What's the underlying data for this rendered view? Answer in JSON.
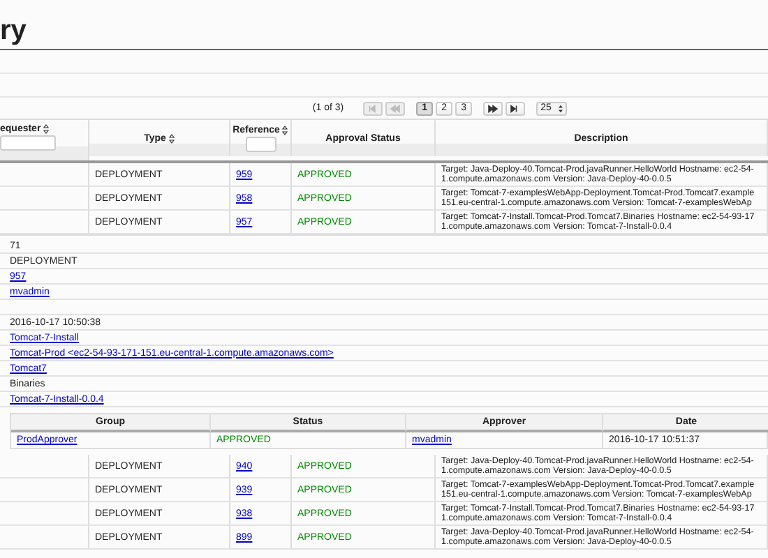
{
  "page": {
    "title": "ry"
  },
  "paginator": {
    "summary": "(1 of 3)",
    "nav": [
      {
        "kind": "first",
        "disabled": true
      },
      {
        "kind": "prev",
        "disabled": true
      },
      {
        "kind": "next",
        "disabled": false
      },
      {
        "kind": "last",
        "disabled": false
      }
    ],
    "pages": [
      {
        "label": "1",
        "selected": true
      },
      {
        "label": "2",
        "selected": false
      },
      {
        "label": "3",
        "selected": false
      }
    ],
    "page_size": "25"
  },
  "table": {
    "columns": [
      {
        "label": "equester",
        "kind": "sort_filter"
      },
      {
        "label": "Type",
        "kind": "sort"
      },
      {
        "label": "Reference",
        "kind": "sort_filter"
      },
      {
        "label": "Approval Status",
        "kind": "plain"
      },
      {
        "label": "Description",
        "kind": "plain"
      }
    ],
    "rows": [
      {
        "type": "DEPLOYMENT",
        "reference": "959",
        "status": "APPROVED",
        "description": [
          "Target: Java-Deploy-40.Tomcat-Prod.javaRunner.HelloWorld Hostname: ec2-54-",
          "1.compute.amazonaws.com Version: Java-Deploy-40-0.0.5"
        ]
      },
      {
        "type": "DEPLOYMENT",
        "reference": "958",
        "status": "APPROVED",
        "description": [
          "Target: Tomcat-7-examplesWebApp-Deployment.Tomcat-Prod.Tomcat7.example",
          "151.eu-central-1.compute.amazonaws.com Version: Tomcat-7-examplesWebAp"
        ]
      },
      {
        "type": "DEPLOYMENT",
        "reference": "957",
        "status": "APPROVED",
        "description": [
          "Target: Tomcat-7-Install.Tomcat-Prod.Tomcat7.Binaries Hostname: ec2-54-93-17",
          "1.compute.amazonaws.com Version: Tomcat-7-Install-0.0.4"
        ],
        "details": [
          {
            "kind": "text",
            "text": "71"
          },
          {
            "kind": "text",
            "text": "DEPLOYMENT"
          },
          {
            "kind": "link",
            "text": "957"
          },
          {
            "kind": "link",
            "text": "mvadmin"
          },
          {
            "kind": "blank"
          },
          {
            "kind": "text",
            "text": "2016-10-17 10:50:38"
          },
          {
            "kind": "link",
            "text": "Tomcat-7-Install"
          },
          {
            "kind": "link",
            "text": "Tomcat-Prod <ec2-54-93-171-151.eu-central-1.compute.amazonaws.com>"
          },
          {
            "kind": "link",
            "text": "Tomcat7"
          },
          {
            "kind": "text",
            "text": "Binaries"
          },
          {
            "kind": "link",
            "text": "Tomcat-7-Install-0.0.4"
          }
        ],
        "approvals": {
          "columns": [
            "Group",
            "Status",
            "Approver",
            "Date"
          ],
          "rows": [
            {
              "group": "ProdApprover",
              "status": "APPROVED",
              "approver": "mvadmin",
              "date": "2016-10-17 10:51:37"
            }
          ]
        }
      },
      {
        "type": "DEPLOYMENT",
        "reference": "940",
        "status": "APPROVED",
        "description": [
          "Target: Java-Deploy-40.Tomcat-Prod.javaRunner.HelloWorld Hostname: ec2-54-",
          "1.compute.amazonaws.com Version: Java-Deploy-40-0.0.5"
        ]
      },
      {
        "type": "DEPLOYMENT",
        "reference": "939",
        "status": "APPROVED",
        "description": [
          "Target: Tomcat-7-examplesWebApp-Deployment.Tomcat-Prod.Tomcat7.example",
          "151.eu-central-1.compute.amazonaws.com Version: Tomcat-7-examplesWebAp"
        ]
      },
      {
        "type": "DEPLOYMENT",
        "reference": "938",
        "status": "APPROVED",
        "description": [
          "Target: Tomcat-7-Install.Tomcat-Prod.Tomcat7.Binaries Hostname: ec2-54-93-17",
          "1.compute.amazonaws.com Version: Tomcat-7-Install-0.0.4"
        ]
      },
      {
        "type": "DEPLOYMENT",
        "reference": "899",
        "status": "APPROVED",
        "description": [
          "Target: Java-Deploy-40.Tomcat-Prod.javaRunner.HelloWorld Hostname: ec2-54-",
          "1.compute.amazonaws.com Version: Java-Deploy-40-0.0.5"
        ]
      }
    ]
  }
}
